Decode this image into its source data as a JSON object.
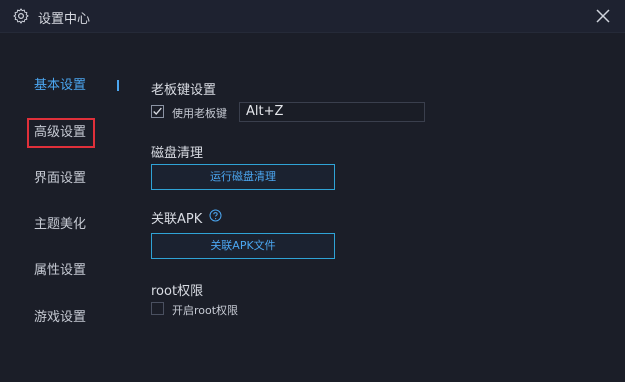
{
  "window": {
    "title": "设置中心"
  },
  "sidebar": {
    "items": [
      {
        "label": "基本设置",
        "active": true
      },
      {
        "label": "高级设置",
        "active": false
      },
      {
        "label": "界面设置",
        "active": false
      },
      {
        "label": "主题美化",
        "active": false
      },
      {
        "label": "属性设置",
        "active": false
      },
      {
        "label": "游戏设置",
        "active": false
      }
    ]
  },
  "boss_key": {
    "title": "老板键设置",
    "checkbox_label": "使用老板键",
    "checked": true,
    "hotkey_value": "Alt+Z"
  },
  "disk": {
    "title": "磁盘清理",
    "button_label": "运行磁盘清理"
  },
  "apk": {
    "title": "关联APK",
    "button_label": "关联APK文件"
  },
  "root": {
    "title": "root权限",
    "checkbox_label": "开启root权限",
    "checked": false
  },
  "colors": {
    "background": "#1b1e28",
    "accent": "#4ba6f0",
    "button_border": "#2fa3d6",
    "highlight_box": "#e0303a"
  },
  "icons": {
    "title": "gear-icon",
    "close": "close-icon",
    "help": "help-icon",
    "checkmark": "checkmark-icon"
  }
}
